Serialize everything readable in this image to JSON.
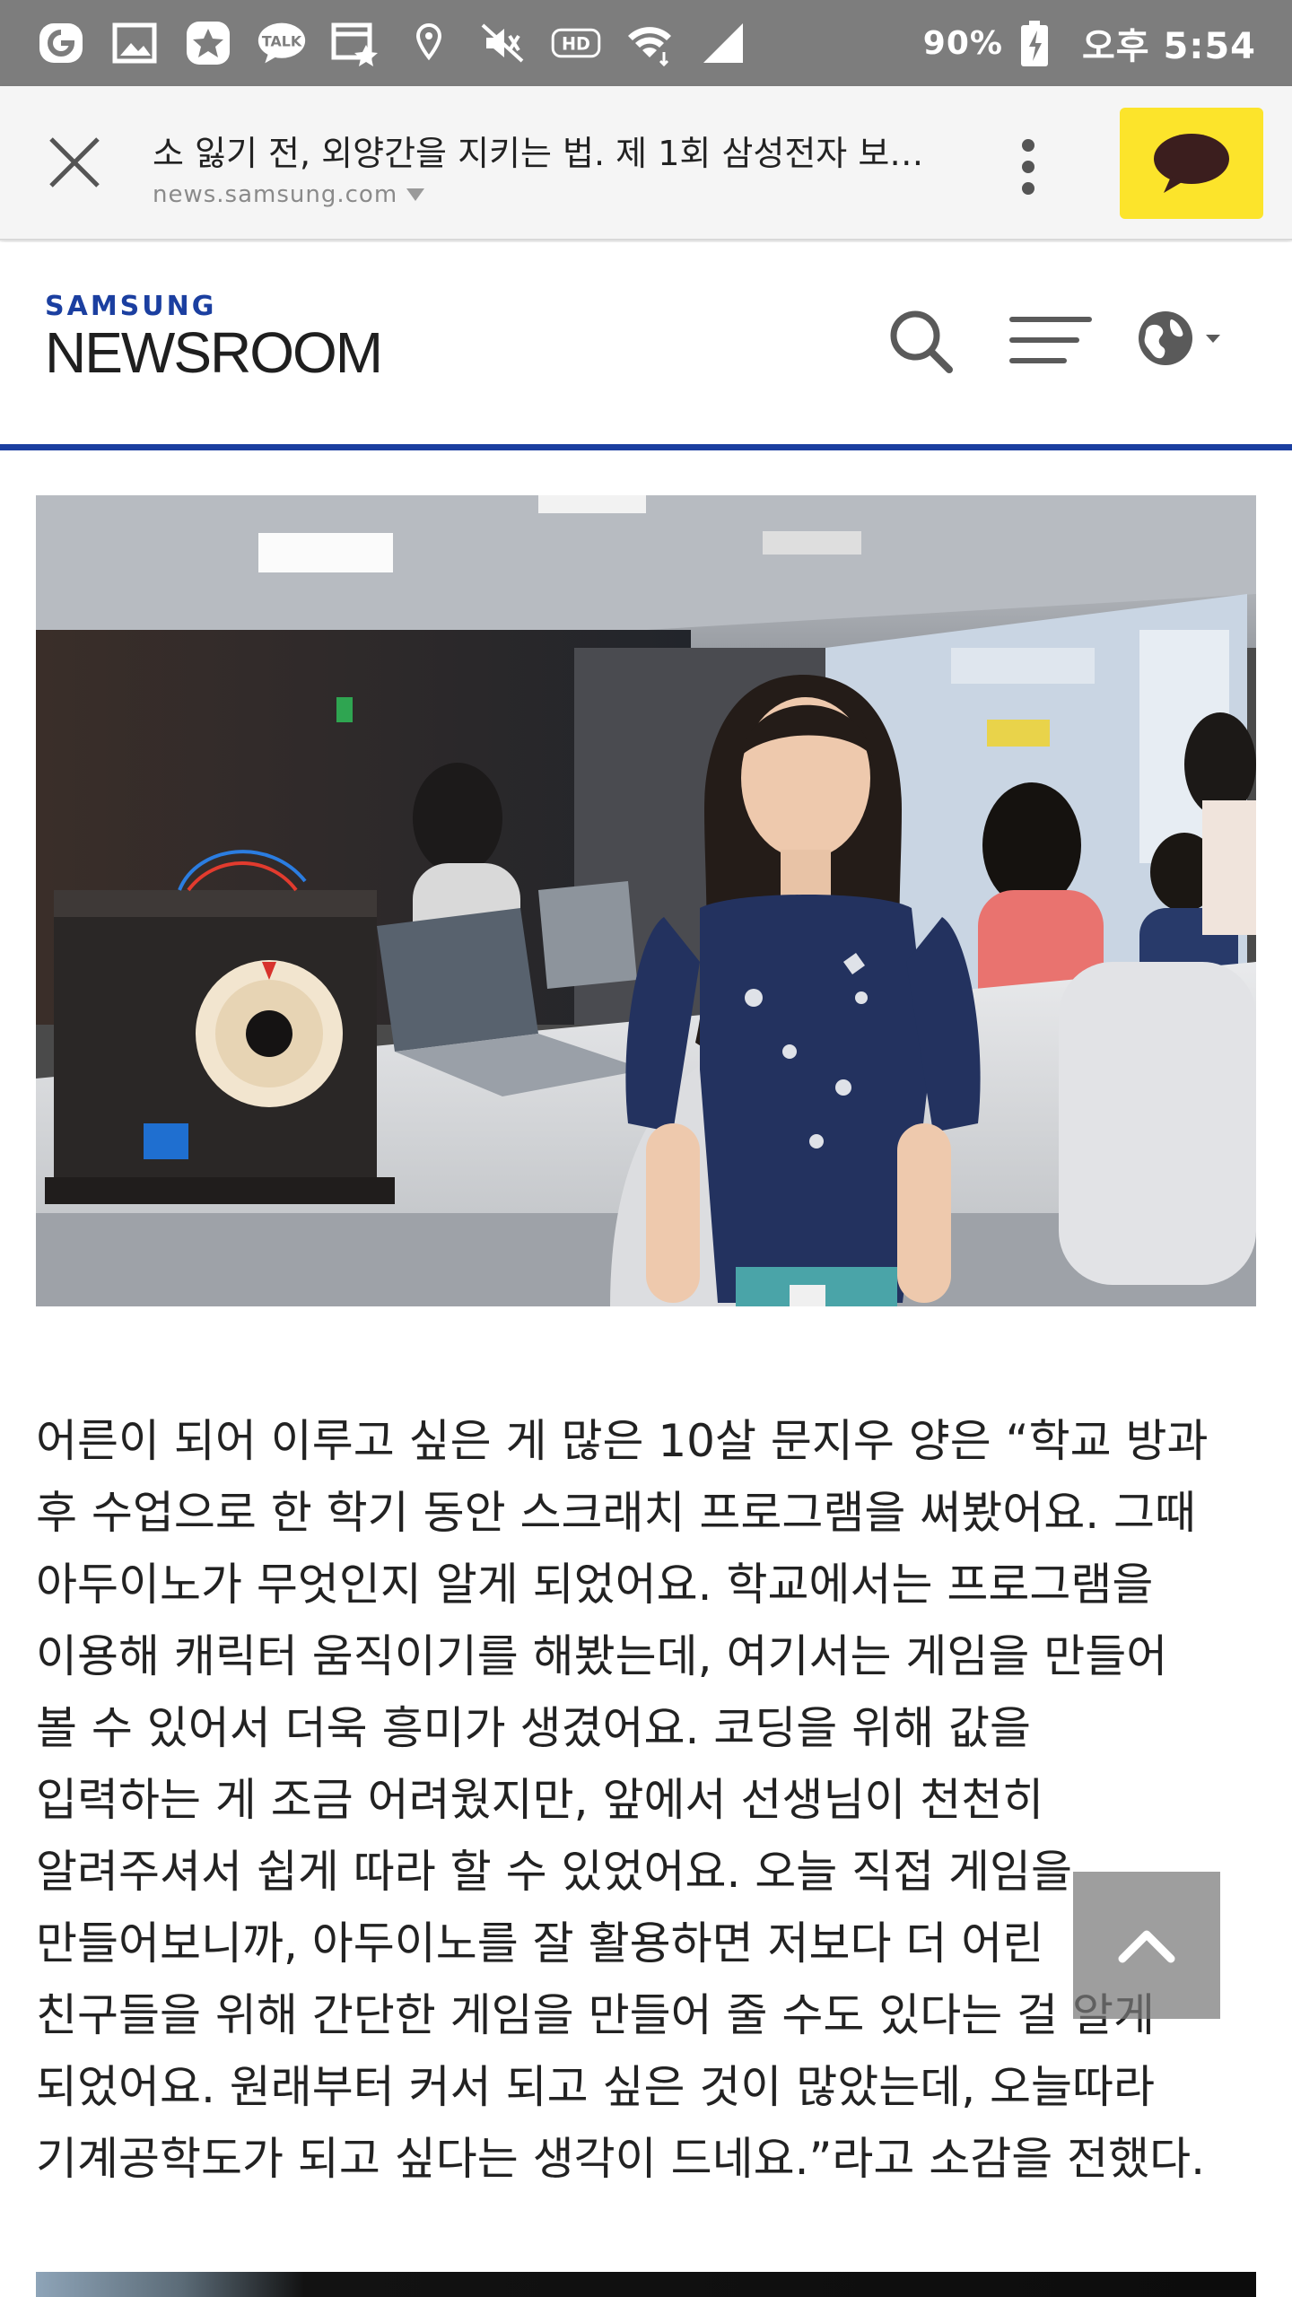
{
  "status_bar": {
    "battery_pct": "90%",
    "time": "오후 5:54",
    "icons": [
      "g-app-icon",
      "gallery-icon",
      "star-icon",
      "kakaotalk-icon",
      "calendar-icon",
      "location-icon",
      "mute-icon",
      "hd-voice-icon",
      "wifi-icon",
      "signal-icon",
      "battery-charging-icon"
    ]
  },
  "toolbar": {
    "page_title": "소 잃기 전, 외양간을 지키는 법. 제 1회 삼성전자 보…",
    "url": "news.samsung.com",
    "colors": {
      "kakao_yellow": "#fce42b"
    }
  },
  "header": {
    "brand": "SAMSUNG",
    "site_name": "NEWSROOM",
    "accent_color": "#1b3fa0"
  },
  "article": {
    "lines": [
      "어른이 되어 이루고 싶은 게 많은 10살 문지우 양은 “학교 방과",
      "후 수업으로 한 학기 동안 스크래치 프로그램을 써봤어요. 그때",
      "아두이노가 무엇인지 알게 되었어요. 학교에서는 프로그램을",
      "이용해 캐릭터 움직이기를 해봤는데, 여기서는 게임을 만들어",
      "볼 수 있어서 더욱 흥미가 생겼어요. 코딩을 위해 값을",
      "입력하는 게 조금 어려웠지만, 앞에서 선생님이 천천히",
      "알려주셔서 쉽게 따라 할 수 있었어요. 오늘 직접 게임을",
      "만들어보니까, 아두이노를 잘 활용하면 저보다 더 어린",
      "친구들을 위해 간단한 게임을 만들어 줄 수도 있다는 걸 알게",
      "되었어요. 원래부터 커서 되고 싶은 것이 많았는데, 오늘따라",
      "기계공학도가 되고 싶다는 생각이 드네요.”라고 소감을 전했다."
    ]
  }
}
